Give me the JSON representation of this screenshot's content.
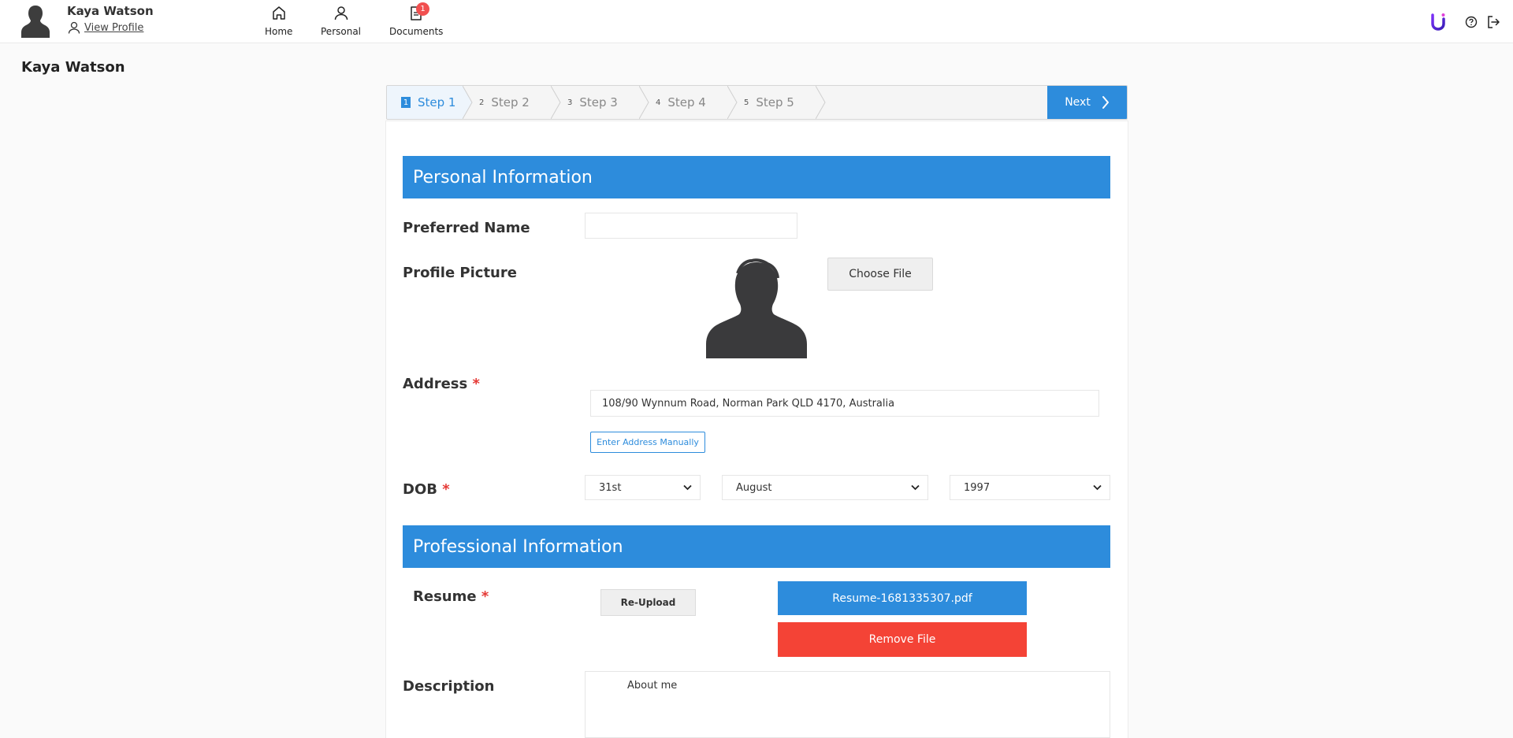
{
  "header": {
    "user_name": "Kaya Watson",
    "view_profile": "View Profile",
    "nav": [
      {
        "label": "Home",
        "icon": "home-icon"
      },
      {
        "label": "Personal",
        "icon": "user-icon"
      },
      {
        "label": "Documents",
        "icon": "document-icon",
        "badge": "1"
      }
    ],
    "brand_icon": "brand-logo-icon",
    "help_icon": "help-icon",
    "logout_icon": "logout-icon"
  },
  "page_title": "Kaya Watson",
  "stepper": {
    "steps": [
      {
        "num": "1",
        "label": "Step 1",
        "active": true
      },
      {
        "num": "2",
        "label": "Step 2"
      },
      {
        "num": "3",
        "label": "Step 3"
      },
      {
        "num": "4",
        "label": "Step 4"
      },
      {
        "num": "5",
        "label": "Step 5"
      }
    ],
    "next_label": "Next"
  },
  "personal": {
    "heading": "Personal Information",
    "preferred_name_label": "Preferred Name",
    "preferred_name_value": "",
    "profile_picture_label": "Profile Picture",
    "choose_file_label": "Choose File",
    "address_label": "Address",
    "address_value": "108/90 Wynnum Road, Norman Park QLD 4170, Australia",
    "enter_address_manually": "Enter Address Manually",
    "dob_label": "DOB",
    "dob_day": "31st",
    "dob_month": "August",
    "dob_year": "1997",
    "required_mark": "*"
  },
  "professional": {
    "heading": "Professional Information",
    "resume_label": "Resume",
    "reupload_label": "Re-Upload",
    "file_name": "Resume-1681335307.pdf",
    "remove_file_label": "Remove File",
    "description_label": "Description",
    "description_value": "About me"
  },
  "colors": {
    "primary": "#2d8cdc",
    "danger": "#f44336",
    "badge": "#f15050"
  }
}
